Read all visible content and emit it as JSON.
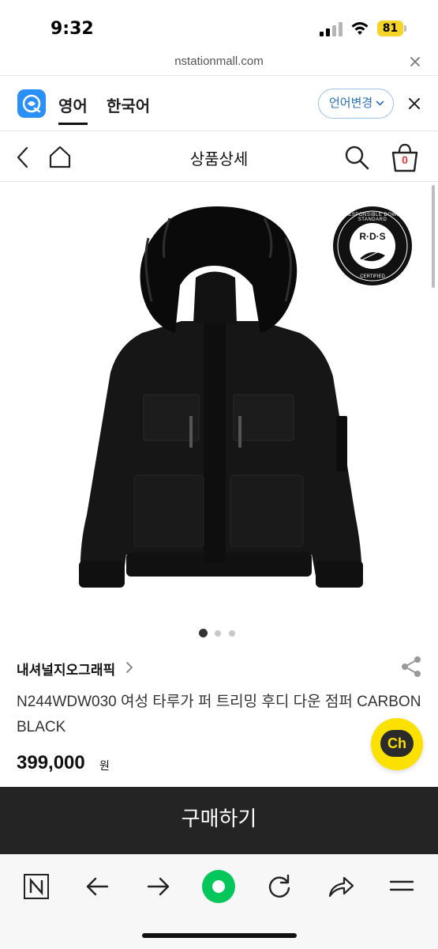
{
  "status_bar": {
    "time": "9:32",
    "battery_level": "81",
    "battery_color": "#f5d425"
  },
  "url_bar": {
    "url": "nstationmall.com",
    "close_icon": "close-icon"
  },
  "translate_bar": {
    "logo_icon": "translate-logo-icon",
    "tabs": [
      {
        "label": "영어",
        "active": true
      },
      {
        "label": "한국어",
        "active": false
      }
    ],
    "change_language_label": "언어변경",
    "accent_color": "#2a8ff7"
  },
  "site_header": {
    "title": "상품상세",
    "cart_count": "0",
    "icons": [
      "back-icon",
      "home-icon",
      "search-icon",
      "cart-icon"
    ]
  },
  "product": {
    "image_description_icon": "jacket-image",
    "badge_text": {
      "top": "RESPONSIBLE DOWN STANDARD",
      "center": "R·D·S",
      "bottom": "CERTIFIED"
    },
    "carousel": {
      "total": 3,
      "current": 1
    },
    "brand": "내셔널지오그래픽",
    "name": "N244WDW030 여성 타루가 퍼 트리밍 후디 다운 점퍼 CARBON BLACK",
    "price": "399,000",
    "price_unit": "원",
    "chat_label": "Ch",
    "chat_color": "#fbe100"
  },
  "buy_button": {
    "label": "구매하기",
    "color": "#242424"
  },
  "browser_bar": {
    "items": [
      "naver-n-icon",
      "back-arrow-icon",
      "forward-arrow-icon",
      "green-dot-home-icon",
      "refresh-icon",
      "share-icon",
      "menu-icon"
    ],
    "green_color": "#03c75a"
  }
}
